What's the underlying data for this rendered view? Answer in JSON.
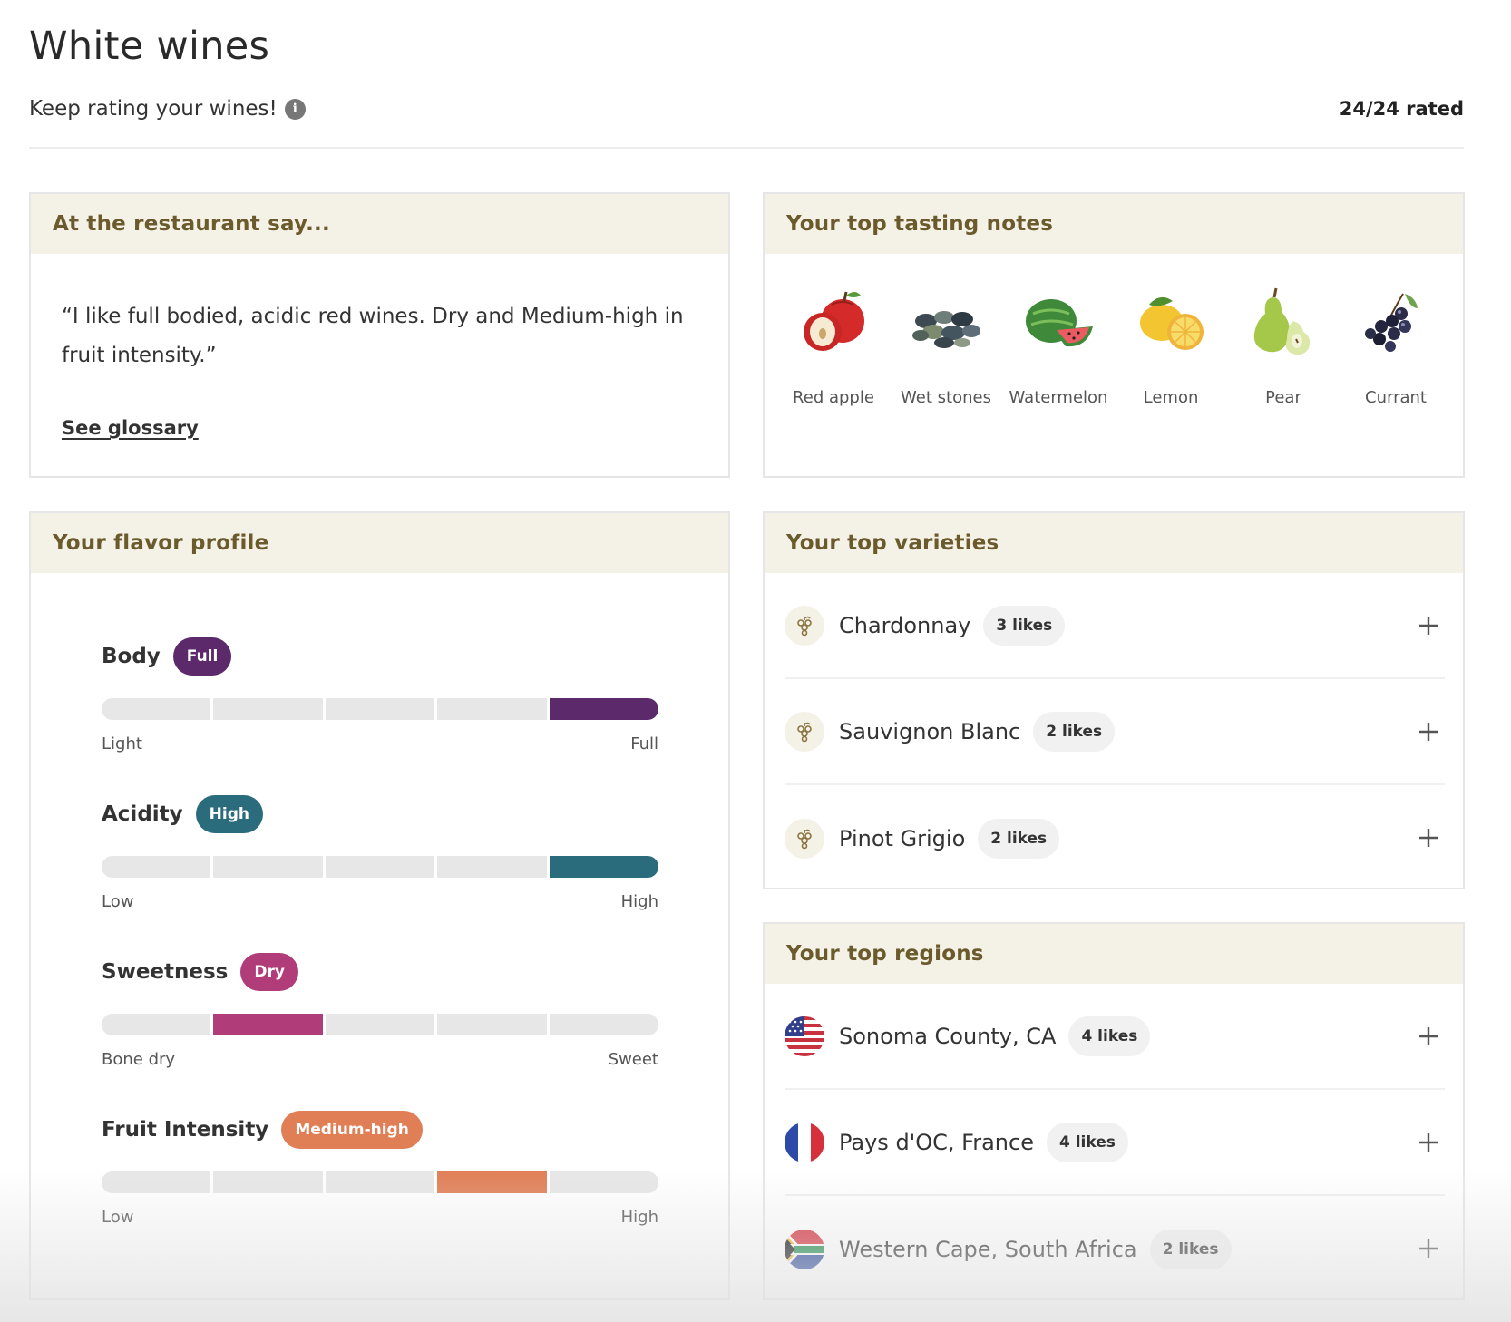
{
  "page": {
    "title": "White wines",
    "subtitle": "Keep rating your wines!",
    "rated": "24/24 rated"
  },
  "restaurant": {
    "header": "At the restaurant say...",
    "quote": "“I like full bodied, acidic red wines. Dry and Medium-high in fruit intensity.”",
    "link": "See glossary"
  },
  "notes": {
    "header": "Your top tasting notes",
    "items": [
      {
        "label": "Red apple",
        "icon": "red-apple-icon"
      },
      {
        "label": "Wet stones",
        "icon": "wet-stones-icon"
      },
      {
        "label": "Watermelon",
        "icon": "watermelon-icon"
      },
      {
        "label": "Lemon",
        "icon": "lemon-icon"
      },
      {
        "label": "Pear",
        "icon": "pear-icon"
      },
      {
        "label": "Currant",
        "icon": "currant-icon"
      }
    ]
  },
  "flavor": {
    "header": "Your flavor profile",
    "items": [
      {
        "name": "Body",
        "badge": "Full",
        "low": "Light",
        "high": "Full",
        "color": "#5c2a6b",
        "level": 5
      },
      {
        "name": "Acidity",
        "badge": "High",
        "low": "Low",
        "high": "High",
        "color": "#2a6b7c",
        "level": 5
      },
      {
        "name": "Sweetness",
        "badge": "Dry",
        "low": "Bone dry",
        "high": "Sweet",
        "color": "#b03c7a",
        "level": 2
      },
      {
        "name": "Fruit Intensity",
        "badge": "Medium-high",
        "low": "Low",
        "high": "High",
        "color": "#e07e55",
        "level": 4
      }
    ]
  },
  "varieties": {
    "header": "Your top varieties",
    "items": [
      {
        "name": "Chardonnay",
        "likes": "3 likes"
      },
      {
        "name": "Sauvignon Blanc",
        "likes": "2 likes"
      },
      {
        "name": "Pinot Grigio",
        "likes": "2 likes"
      }
    ]
  },
  "regions": {
    "header": "Your top regions",
    "items": [
      {
        "name": "Sonoma County, CA",
        "likes": "4 likes",
        "flag": "us-flag-icon"
      },
      {
        "name": "Pays d'OC, France",
        "likes": "4 likes",
        "flag": "france-flag-icon"
      },
      {
        "name": "Western Cape, South Africa",
        "likes": "2 likes",
        "flag": "south-africa-flag-icon"
      }
    ]
  }
}
